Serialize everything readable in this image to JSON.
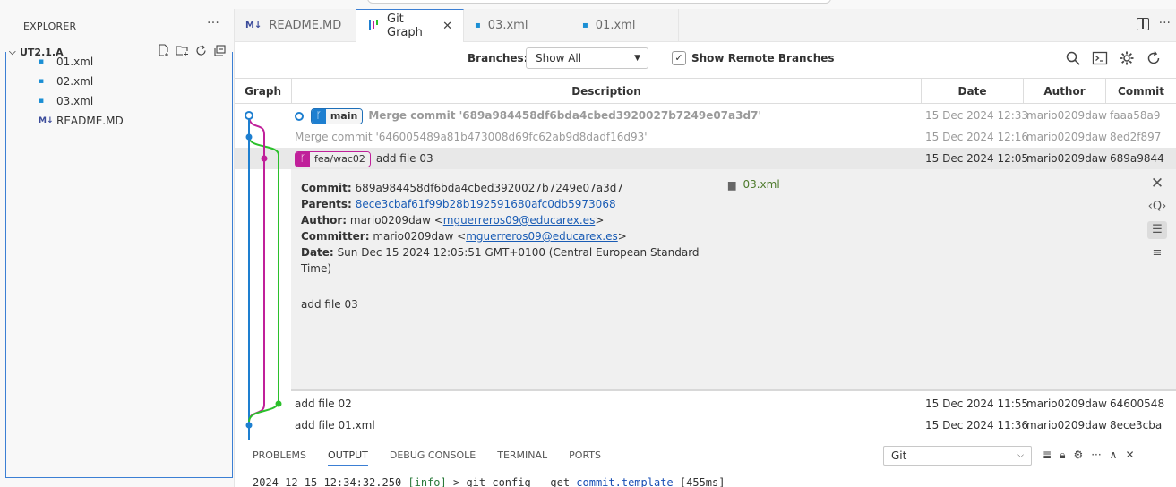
{
  "sidebar": {
    "title": "EXPLORER",
    "more": "···",
    "folder": "UT2.1.A",
    "files": [
      {
        "name": "01.xml",
        "icon": "xml-file-icon"
      },
      {
        "name": "02.xml",
        "icon": "xml-file-icon"
      },
      {
        "name": "03.xml",
        "icon": "xml-file-icon"
      },
      {
        "name": "README.MD",
        "icon": "markdown-file-icon"
      }
    ]
  },
  "tabs": [
    {
      "label": "README.MD",
      "icon": "markdown-file-icon",
      "active": false
    },
    {
      "label": "Git Graph",
      "icon": "git-graph-icon",
      "active": true,
      "close": "✕"
    },
    {
      "label": "03.xml",
      "icon": "xml-file-icon",
      "active": false
    },
    {
      "label": "01.xml",
      "icon": "xml-file-icon",
      "active": false
    }
  ],
  "toolbar": {
    "branches_label": "Branches:",
    "branches_value": "Show All",
    "remote_checked": true,
    "remote_label": "Show Remote Branches"
  },
  "table": {
    "headers": {
      "graph": "Graph",
      "description": "Description",
      "date": "Date",
      "author": "Author",
      "commit": "Commit"
    },
    "rows": [
      {
        "ref": "main",
        "description": "Merge commit '689a984458df6bda4cbed3920027b7249e07a3d7'",
        "date": "15 Dec 2024 12:33",
        "author": "mario0209daw",
        "commit": "faaa58a9"
      },
      {
        "description": "Merge commit '646005489a81b473008d69fc62ab9d8dadf16d93'",
        "date": "15 Dec 2024 12:16",
        "author": "mario0209daw",
        "commit": "8ed2f897"
      },
      {
        "ref": "fea/wac02",
        "description": "add file 03",
        "date": "15 Dec 2024 12:05",
        "author": "mario0209daw",
        "commit": "689a9844"
      },
      {
        "description": "add file 02",
        "date": "15 Dec 2024 11:55",
        "author": "mario0209daw",
        "commit": "64600548"
      },
      {
        "description": "add file 01.xml",
        "date": "15 Dec 2024 11:36",
        "author": "mario0209daw",
        "commit": "8ece3cba"
      }
    ]
  },
  "details": {
    "commit_label": "Commit:",
    "commit_value": "689a984458df6bda4cbed3920027b7249e07a3d7",
    "parents_label": "Parents:",
    "parents_value": "8ece3cbaf61f99b28b192591680afc0db5973068",
    "author_label": "Author:",
    "author_name": "mario0209daw",
    "author_email": "mguerreros09@educarex.es",
    "committer_label": "Committer:",
    "committer_name": "mario0209daw",
    "committer_email": "mguerreros09@educarex.es",
    "date_label": "Date:",
    "date_value": "Sun Dec 15 2024 12:05:51 GMT+0100 (Central European Standard Time)",
    "message": "add file 03",
    "files": [
      "03.xml"
    ]
  },
  "graph": {
    "colors": {
      "main": "#1e7fd0",
      "fea": "#c0209a",
      "green": "#2bc02b"
    }
  },
  "panel": {
    "tabs": [
      "PROBLEMS",
      "OUTPUT",
      "DEBUG CONSOLE",
      "TERMINAL",
      "PORTS"
    ],
    "active_tab": "OUTPUT",
    "channel": "Git",
    "log_time": "2024-12-15 12:34:32.250",
    "log_level": "[info]",
    "log_cmd": "> git config --get",
    "log_key": "commit.template",
    "log_dur": "[455ms]"
  }
}
